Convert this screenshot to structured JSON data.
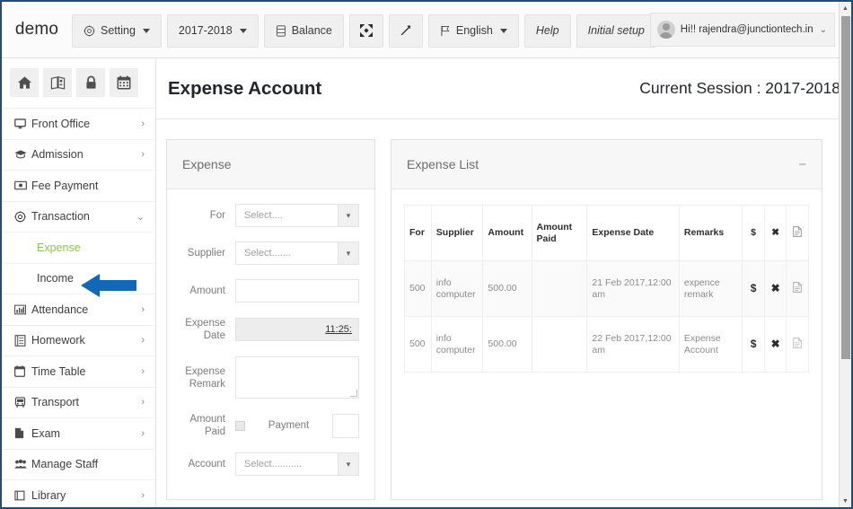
{
  "topbar": {
    "brand": "demo",
    "buttons": [
      {
        "name": "setting",
        "label": "Setting",
        "icon": "gear-icon",
        "caret": true
      },
      {
        "name": "session-year",
        "label": "2017-2018",
        "icon": null,
        "caret": true
      },
      {
        "name": "balance",
        "label": "Balance",
        "icon": "database-icon",
        "caret": false
      },
      {
        "name": "expand",
        "label": "",
        "icon": "arrows-alt-icon",
        "caret": false
      },
      {
        "name": "resize",
        "label": "",
        "icon": "expand-diagonal-icon",
        "caret": false
      },
      {
        "name": "language",
        "label": "English",
        "icon": "flag-icon",
        "caret": true
      },
      {
        "name": "help",
        "label": "Help",
        "icon": null,
        "caret": false
      },
      {
        "name": "initial-setup",
        "label": "Initial setup",
        "icon": null,
        "caret": false
      }
    ],
    "user": {
      "greeting": "Hi!! rajendra@junctiontech.in",
      "caret": "⌄"
    }
  },
  "sidebar": {
    "quick_icons": [
      {
        "name": "home-icon"
      },
      {
        "name": "id-card-icon"
      },
      {
        "name": "lock-icon"
      },
      {
        "name": "calendar-icon"
      }
    ],
    "items": [
      {
        "label": "Front Office",
        "icon": "desktop-icon",
        "arrow": "›",
        "type": "parent"
      },
      {
        "label": "Admission",
        "icon": "graduation-cap-icon",
        "arrow": "›",
        "type": "parent"
      },
      {
        "label": "Fee Payment",
        "icon": "money-icon",
        "arrow": "",
        "type": "leaf"
      },
      {
        "label": "Transaction",
        "icon": "gear-circle-icon",
        "arrow": "⌄",
        "type": "parent-open"
      },
      {
        "label": "Expense",
        "icon": "",
        "arrow": "",
        "type": "sub-active"
      },
      {
        "label": "Income",
        "icon": "",
        "arrow": "",
        "type": "sub"
      },
      {
        "label": "Attendance",
        "icon": "chart-bar-icon",
        "arrow": "›",
        "type": "parent"
      },
      {
        "label": "Homework",
        "icon": "book-icon",
        "arrow": "›",
        "type": "parent"
      },
      {
        "label": "Time Table",
        "icon": "calendar-icon",
        "arrow": "›",
        "type": "parent"
      },
      {
        "label": "Transport",
        "icon": "bus-icon",
        "arrow": "›",
        "type": "parent"
      },
      {
        "label": "Exam",
        "icon": "file-icon",
        "arrow": "›",
        "type": "parent"
      },
      {
        "label": "Manage Staff",
        "icon": "users-icon",
        "arrow": "",
        "type": "leaf"
      },
      {
        "label": "Library",
        "icon": "book-open-icon",
        "arrow": "›",
        "type": "parent"
      }
    ],
    "annotation": {
      "name": "blue-left-arrow",
      "color": "#1168b8",
      "points_at": "Transaction"
    }
  },
  "page": {
    "title": "Expense Account",
    "session_label": "Current Session : 2017-2018"
  },
  "expense_form": {
    "panel_title": "Expense",
    "fields": {
      "for_label": "For",
      "for_placeholder": "Select....",
      "supplier_label": "Supplier",
      "supplier_placeholder": "Select.......",
      "amount_label": "Amount",
      "amount_value": "",
      "expense_date_label": "Expense Date",
      "expense_date_value": "11:25:",
      "expense_remark_label": "Expense Remark",
      "expense_remark_value": "",
      "amount_paid_label": "Amount Paid",
      "payment_label": "Payment",
      "payment_value": "",
      "account_label": "Account",
      "account_placeholder": "Select..........."
    }
  },
  "expense_list": {
    "panel_title": "Expense List",
    "collapse_icon": "−",
    "columns": [
      "For",
      "Supplier",
      "Amount",
      "Amount Paid",
      "Expense Date",
      "Remarks",
      "$",
      "✖",
      "doc-icon"
    ],
    "rows": [
      {
        "for": "500",
        "supplier": "info computer",
        "amount": "500.00",
        "amount_paid": "",
        "expense_date": "21 Feb 2017,12:00 am",
        "remarks": "expence remark",
        "pay_action": "$",
        "delete_action": "✖",
        "doc_action": "doc-icon"
      },
      {
        "for": "500",
        "supplier": "info computer",
        "amount": "500.00",
        "amount_paid": "",
        "expense_date": "22 Feb 2017,12:00 am",
        "remarks": "Expense Account",
        "pay_action": "$",
        "delete_action": "✖",
        "doc_action": "doc-icon"
      }
    ]
  },
  "scrollbar": {
    "up": "▲",
    "down": "▼"
  }
}
